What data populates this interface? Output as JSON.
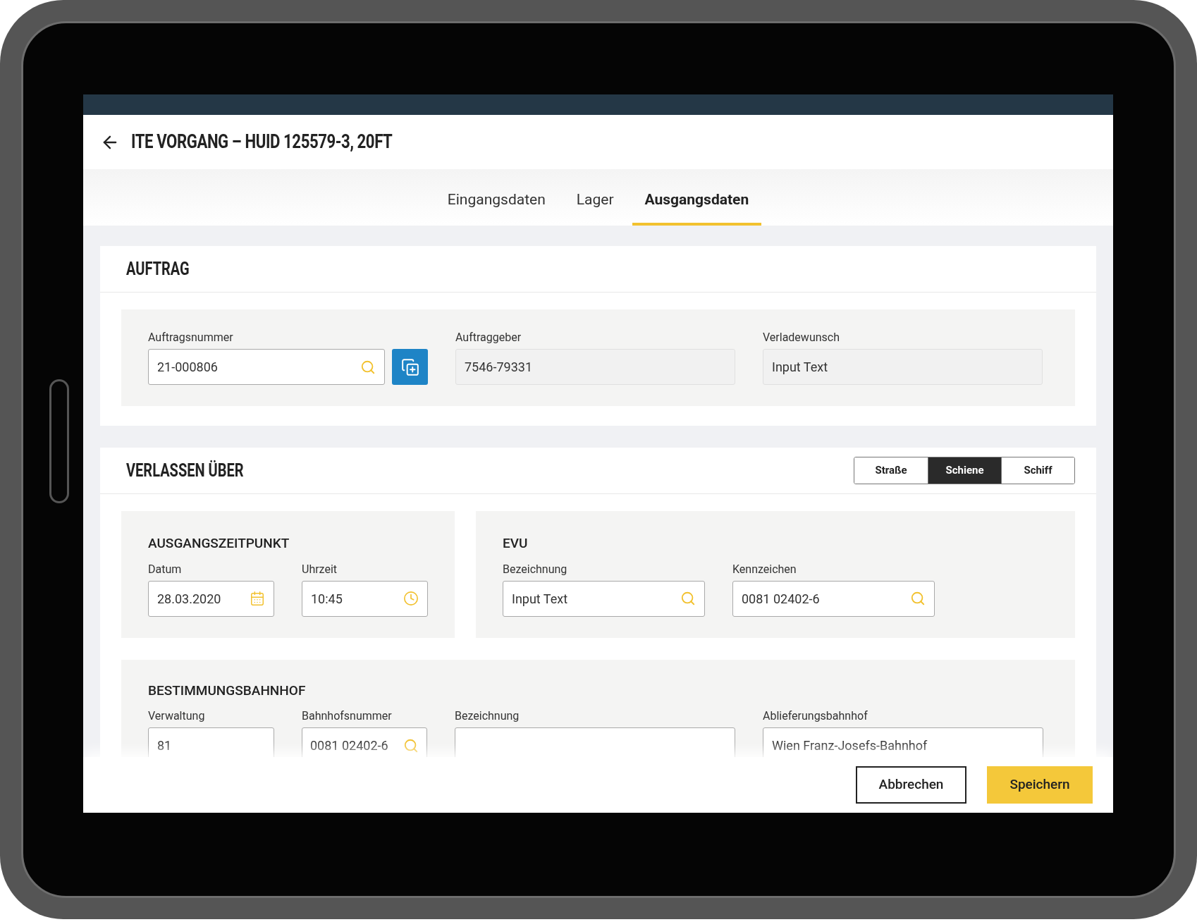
{
  "header": {
    "title": "ITE VORGANG – HUID 125579-3, 20FT"
  },
  "tabs": [
    {
      "label": "Eingangsdaten",
      "selected": false
    },
    {
      "label": "Lager",
      "selected": false
    },
    {
      "label": "Ausgangsdaten",
      "selected": true
    }
  ],
  "order": {
    "title": "AUFTRAG",
    "fields": [
      {
        "label": "Auftragsnummer",
        "value": "21-000806",
        "kind": "search",
        "disabled": false,
        "action": true
      },
      {
        "label": "Auftraggeber",
        "value": "7546-79331",
        "kind": "text",
        "disabled": true,
        "action": false
      },
      {
        "label": "Verladewunsch",
        "value": "Input Text",
        "kind": "text",
        "disabled": true,
        "action": false
      }
    ]
  },
  "departure": {
    "title": "VERLASSEN ÜBER",
    "modes": [
      {
        "label": "Straße",
        "selected": false
      },
      {
        "label": "Schiene",
        "selected": true
      },
      {
        "label": "Schiff",
        "selected": false
      }
    ],
    "exit_time": {
      "title": "AUSGANGSZEITPUNKT",
      "fields": [
        {
          "label": "Datum",
          "value": "28.03.2020",
          "kind": "date",
          "disabled": false
        },
        {
          "label": "Uhrzeit",
          "value": "10:45",
          "kind": "time",
          "disabled": false
        }
      ]
    },
    "evu": {
      "title": "EVU",
      "fields": [
        {
          "label": "Bezeichnung",
          "value": "Input Text",
          "kind": "search",
          "disabled": false
        },
        {
          "label": "Kennzeichen",
          "value": "0081 02402-6",
          "kind": "search",
          "disabled": false
        }
      ]
    },
    "station": {
      "title": "BESTIMMUNGSBAHNHOF",
      "fields": [
        {
          "label": "Verwaltung",
          "value": "81",
          "kind": "text",
          "disabled": false
        },
        {
          "label": "Bahnhofsnummer",
          "value": "0081 02402-6",
          "kind": "search",
          "disabled": false
        },
        {
          "label": "Bezeichnung",
          "kind": "text",
          "disabled": false
        },
        {
          "label": "Ablieferungsbahnhof",
          "value": "Wien Franz-Josefs-Bahnhof",
          "kind": "text",
          "disabled": false
        }
      ]
    }
  },
  "footer": {
    "cancel": "Abbrechen",
    "save": "Speichern"
  }
}
